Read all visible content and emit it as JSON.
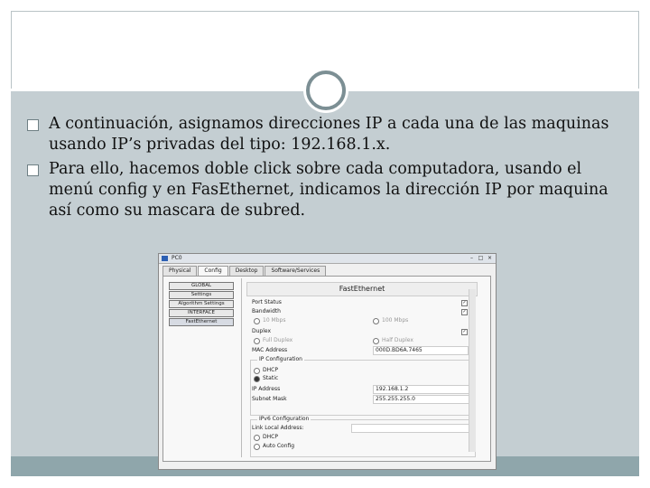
{
  "slide": {
    "bullets": [
      "A continuación, asignamos direcciones IP a cada una de las maquinas usando IP’s privadas del tipo: 192.168.1.x.",
      "Para ello, hacemos doble click sobre cada computadora, usando el menú config y en FasEthernet, indicamos la dirección IP por maquina así como su mascara de subred."
    ]
  },
  "window": {
    "title": "PC0",
    "tabs": [
      "Physical",
      "Config",
      "Desktop",
      "Software/Services"
    ],
    "active_tab": "Config",
    "left_menu": [
      "GLOBAL",
      "Settings",
      "Algorithm Settings",
      "INTERFACE",
      "FastEthernet"
    ],
    "section_title": "FastEthernet",
    "labels": {
      "port_status": "Port Status",
      "bandwidth": "Bandwidth",
      "mbps10": "10 Mbps",
      "mbps100": "100 Mbps",
      "duplex": "Duplex",
      "full_duplex": "Full Duplex",
      "half_duplex": "Half Duplex",
      "mac": "MAC Address",
      "ip_config": "IP Configuration",
      "dhcp": "DHCP",
      "static": "Static",
      "ip_address": "IP Address",
      "subnet_mask": "Subnet Mask",
      "ipv6_config": "IPv6 Configuration",
      "link_local": "Link Local Address:",
      "dhcp6": "DHCP",
      "auto_config": "Auto Config"
    },
    "values": {
      "mac": "000D.BD6A.7465",
      "ip_address": "192.168.1.2",
      "subnet_mask": "255.255.255.0"
    },
    "checks": {
      "port_status": "✓",
      "bandwidth_auto": "✓",
      "duplex_auto": "✓"
    }
  }
}
